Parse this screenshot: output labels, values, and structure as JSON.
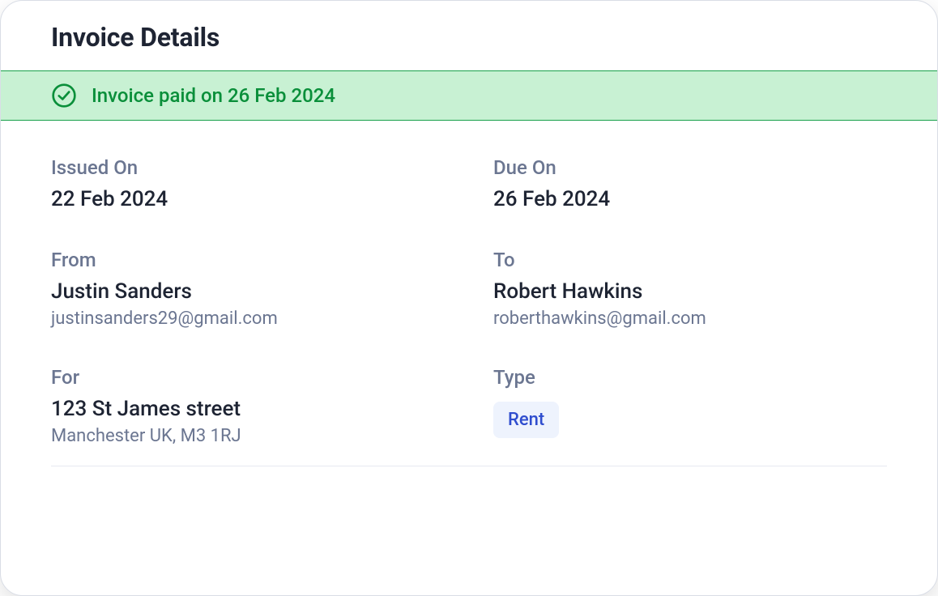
{
  "title": "Invoice Details",
  "status": {
    "text": "Invoice paid on 26 Feb 2024"
  },
  "fields": {
    "issuedOn": {
      "label": "Issued On",
      "value": "22 Feb 2024"
    },
    "dueOn": {
      "label": "Due On",
      "value": "26 Feb 2024"
    },
    "from": {
      "label": "From",
      "name": "Justin Sanders",
      "email": "justinsanders29@gmail.com"
    },
    "to": {
      "label": "To",
      "name": "Robert Hawkins",
      "email": "roberthawkins@gmail.com"
    },
    "for": {
      "label": "For",
      "line1": "123 St James street",
      "line2": "Manchester UK, M3 1RJ"
    },
    "type": {
      "label": "Type",
      "value": "Rent"
    }
  }
}
